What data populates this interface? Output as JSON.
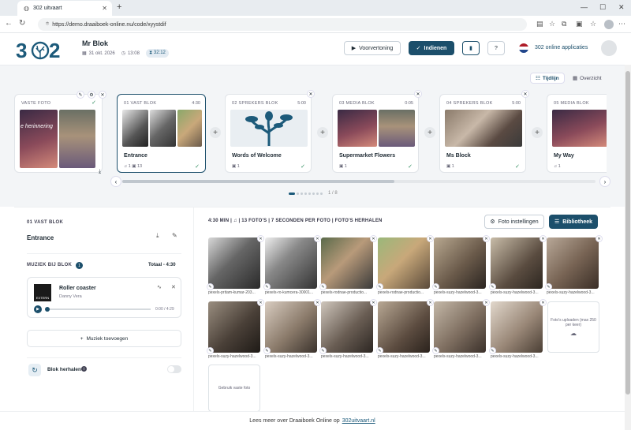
{
  "browser": {
    "tab_title": "302 uitvaart",
    "url": "https://demo.draaiboek-online.nu/code/xyystdif"
  },
  "header": {
    "logo": "302",
    "client_name": "Mr Blok",
    "date": "31 okt. 2026",
    "time": "13:08",
    "duration": "32:12",
    "preview_label": "Voorvertoning",
    "submit_label": "Indienen",
    "help_label": "?",
    "apps_label": "302 online applicaties"
  },
  "view": {
    "timeline_label": "Tijdlijn",
    "overview_label": "Overzicht"
  },
  "blocks": [
    {
      "head": "VASTE FOTO",
      "time": "",
      "title": "",
      "foot": ""
    },
    {
      "head": "01 VAST BLOK",
      "time": "4:30",
      "title": "Entrance",
      "foot": "♫ 1   ▣ 13"
    },
    {
      "head": "02 SPREKERS BLOK",
      "time": "5:00",
      "title": "Words of Welcome",
      "foot": "▣ 1"
    },
    {
      "head": "03 MEDIA BLOK",
      "time": "0:05",
      "title": "Supermarket Flowers",
      "foot": "▣ 1"
    },
    {
      "head": "04 SPREKERS BLOK",
      "time": "5:00",
      "title": "Ms Block",
      "foot": "▣ 1"
    },
    {
      "head": "05 MEDIA BLOK",
      "time": "",
      "title": "My Way",
      "foot": "♫ 1"
    }
  ],
  "card_image_text": "e herinnering",
  "pager": "1 / 8",
  "detail": {
    "block_head": "01  VAST BLOK",
    "block_name": "Entrance",
    "music_head": "MUZIEK BIJ BLOK",
    "music_count": "1",
    "total": "Totaal - 4:30",
    "song_title": "Roller coaster",
    "song_artist": "Danny Vera",
    "album_label": "EXTERN",
    "song_time": "0:00 / 4:29",
    "add_music": "Muziek toevoegen",
    "repeat_label": "Blok herhalen",
    "summary": "4:30 MIN | ♫ | 13 FOTO'S | 7 SECONDEN PER FOTO | FOTO'S HERHALEN",
    "photo_settings": "Foto instellingen",
    "library": "Bibliotheek",
    "upload_text": "Foto's uploaden (max 250 per keer)",
    "fixed_photo": "Gebruik vaste foto"
  },
  "photos": [
    "pexels-pritam-kumar-203...",
    "pexels-ro-kumcera-30001...",
    "pexels-rodnae-productio...",
    "pexels-rodnae-productio...",
    "pexels-suzy-hazelwood-3...",
    "pexels-suzy-hazelwood-3...",
    "pexels-suzy-hazelwood-3...",
    "pexels-suzy-hazelwood-3...",
    "pexels-suzy-hazelwood-3...",
    "pexels-suzy-hazelwood-3...",
    "pexels-suzy-hazelwood-3...",
    "pexels-suzy-hazelwood-3...",
    "pexels-suzy-hazelwood-3..."
  ],
  "footer": {
    "text": "Lees meer over Draaiboek Online op",
    "link": "302uitvaart.nl"
  },
  "colors": {
    "primary": "#1c4f6b",
    "accent": "#1c5a7a"
  }
}
